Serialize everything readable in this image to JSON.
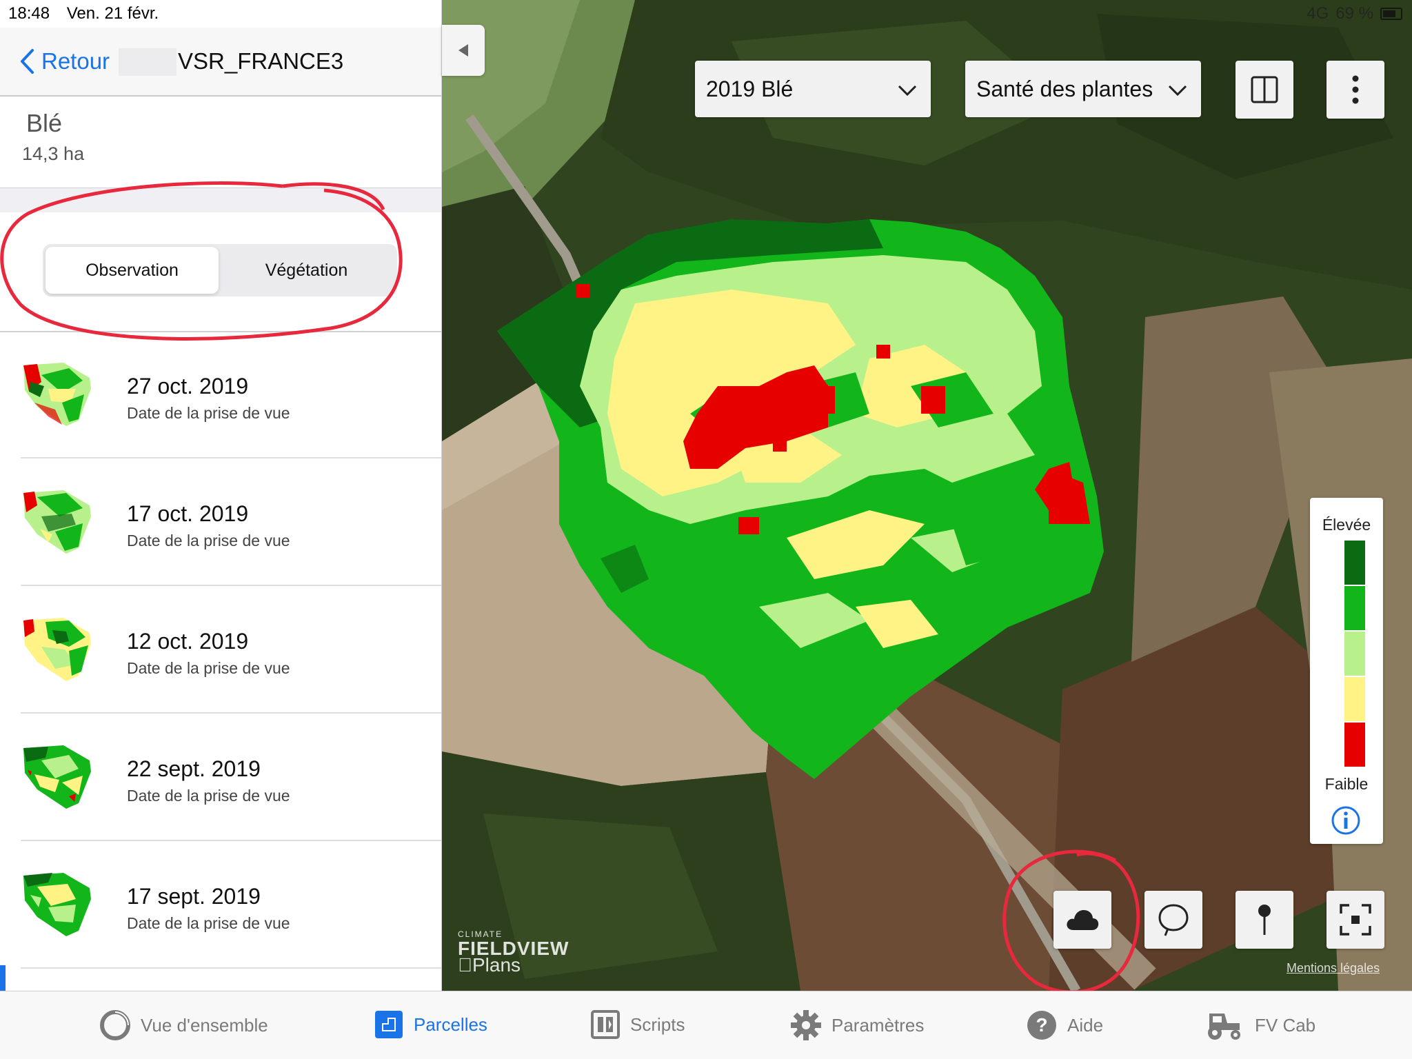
{
  "status": {
    "time": "18:48",
    "date": "Ven. 21 févr.",
    "signal": "4G",
    "battery": "69 %"
  },
  "nav": {
    "back_label": "Retour",
    "title": "VSR_FRANCE3"
  },
  "field": {
    "crop": "Blé",
    "area": "14,3 ha"
  },
  "segment": {
    "observation": "Observation",
    "vegetation": "Végétation",
    "selected": "Observation"
  },
  "imagery": [
    {
      "date": "27 oct. 2019",
      "caption": "Date de la prise de vue"
    },
    {
      "date": "17 oct. 2019",
      "caption": "Date de la prise de vue"
    },
    {
      "date": "12 oct. 2019",
      "caption": "Date de la prise de vue"
    },
    {
      "date": "22 sept. 2019",
      "caption": "Date de la prise de vue"
    },
    {
      "date": "17 sept. 2019",
      "caption": "Date de la prise de vue"
    }
  ],
  "map": {
    "season_dropdown": "2019 Blé",
    "layer_dropdown": "Santé des plantes",
    "legend_high": "Élevée",
    "legend_low": "Faible",
    "legend_colors": [
      "#0a6b12",
      "#12b51a",
      "#b8f08c",
      "#fff385",
      "#e60000"
    ],
    "watermark_small": "CLIMATE",
    "watermark_brand": "FIELDVIEW",
    "watermark_maps": "Plans",
    "mentions": "Mentions légales"
  },
  "tabs": [
    {
      "label": "Vue d'ensemble",
      "icon": "ring-icon"
    },
    {
      "label": "Parcelles",
      "icon": "field-icon",
      "active": true
    },
    {
      "label": "Scripts",
      "icon": "script-icon"
    },
    {
      "label": "Paramètres",
      "icon": "gear-icon"
    },
    {
      "label": "Aide",
      "icon": "help-icon"
    },
    {
      "label": "FV Cab",
      "icon": "tractor-icon"
    }
  ]
}
